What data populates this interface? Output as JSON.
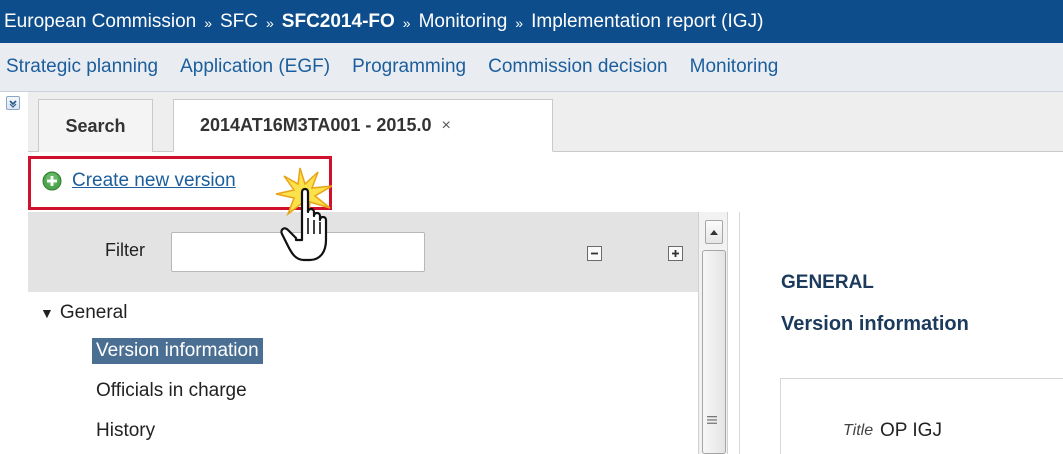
{
  "breadcrumb": {
    "items": [
      "European Commission",
      "SFC",
      "SFC2014-FO",
      "Monitoring",
      "Implementation report (IGJ)"
    ],
    "separator": "»"
  },
  "menu": {
    "items": [
      "Strategic planning",
      "Application (EGF)",
      "Programming",
      "Commission decision",
      "Monitoring"
    ]
  },
  "tabs": {
    "search_label": "Search",
    "report_label": "2014AT16M3TA001 - 2015.0",
    "close_glyph": "×"
  },
  "toolbar": {
    "create_new_version_label": "Create new version"
  },
  "filter": {
    "label": "Filter",
    "value": ""
  },
  "tree": {
    "group_label": "General",
    "expanded_glyph": "▼",
    "items": [
      "Version information",
      "Officials in charge",
      "History"
    ],
    "selected_index": 0
  },
  "content": {
    "section_title": "GENERAL",
    "section_subtitle": "Version information",
    "title_field_label": "Title",
    "title_field_value": "OP IGJ"
  },
  "colors": {
    "breadcrumb_bg": "#0d4d8c",
    "link": "#1c5e9c",
    "highlight_border": "#d0102c",
    "selected_bg": "#4a6f93",
    "heading": "#1b3a5c"
  }
}
